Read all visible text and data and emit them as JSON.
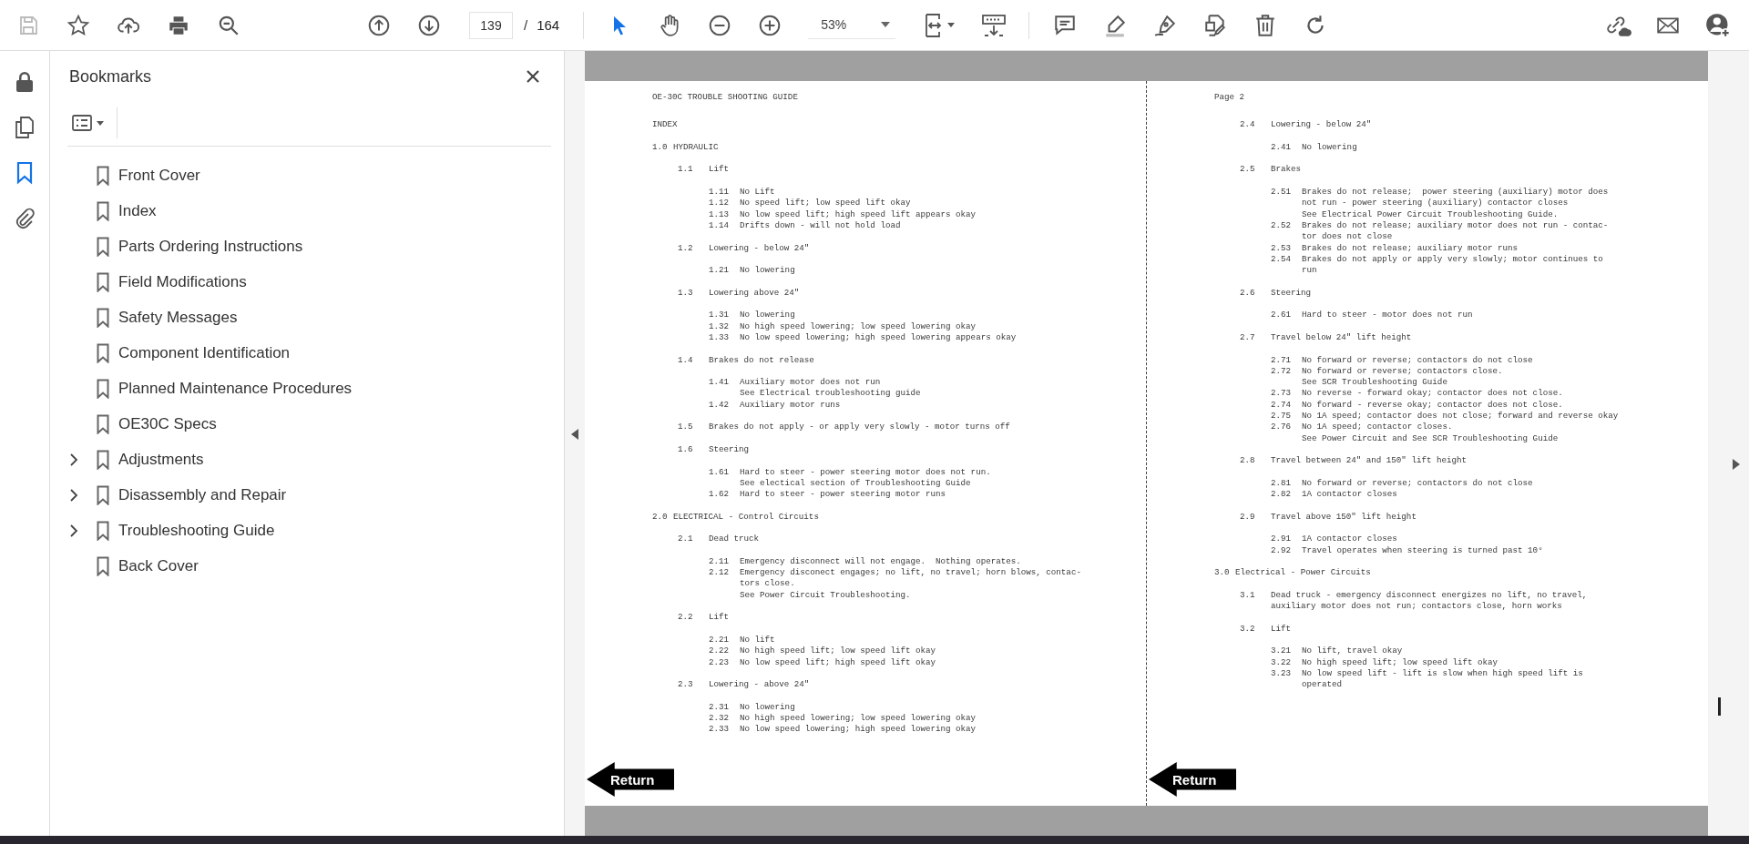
{
  "toolbar": {
    "save": {
      "disabled": true
    },
    "page_number": "139",
    "page_separator": "/",
    "page_count": "164",
    "zoom": "53%",
    "tools": [
      {
        "kind": "select",
        "selected": true
      },
      {
        "kind": "hand",
        "selected": false
      }
    ]
  },
  "nav_rail": [
    {
      "kind": "lock",
      "selected": false
    },
    {
      "kind": "pages",
      "selected": false
    },
    {
      "kind": "bookmarks",
      "selected": true
    },
    {
      "kind": "attachments",
      "selected": false
    }
  ],
  "bookmarks_panel": {
    "title": "Bookmarks",
    "items": [
      {
        "label": "Front Cover",
        "expandable": false
      },
      {
        "label": "Index",
        "expandable": false
      },
      {
        "label": "Parts Ordering Instructions",
        "expandable": false
      },
      {
        "label": "Field Modifications",
        "expandable": false
      },
      {
        "label": "Safety Messages",
        "expandable": false
      },
      {
        "label": "Component Identification",
        "expandable": false
      },
      {
        "label": "Planned Maintenance Procedures",
        "expandable": false
      },
      {
        "label": "OE30C Specs",
        "expandable": false
      },
      {
        "label": "Adjustments",
        "expandable": true
      },
      {
        "label": "Disassembly and Repair",
        "expandable": true
      },
      {
        "label": "Troubleshooting Guide",
        "expandable": true
      },
      {
        "label": "Back Cover",
        "expandable": false
      }
    ]
  },
  "document": {
    "pages": [
      {
        "return_link": "Return",
        "blocks": [
          {
            "kind": "header",
            "lines": [
              "OE-30C TROUBLE SHOOTING GUIDE"
            ]
          },
          {
            "kind": "title",
            "lines": [
              "INDEX"
            ]
          },
          {
            "kind": "section",
            "number": "1.0",
            "lines": [
              "HYDRAULIC"
            ]
          },
          {
            "kind": "subsection",
            "number": "1.1",
            "lines": [
              "Lift"
            ]
          },
          {
            "kind": "item",
            "number": "1.11",
            "lines": [
              "No Lift"
            ]
          },
          {
            "kind": "item",
            "number": "1.12",
            "lines": [
              "No speed lift; low speed lift okay"
            ]
          },
          {
            "kind": "item",
            "number": "1.13",
            "lines": [
              "No low speed lift; high speed lift appears okay"
            ]
          },
          {
            "kind": "item",
            "number": "1.14",
            "lines": [
              "Drifts down - will not hold load"
            ]
          },
          {
            "kind": "subsection",
            "number": "1.2",
            "lines": [
              "Lowering - below 24\""
            ]
          },
          {
            "kind": "item",
            "number": "1.21",
            "lines": [
              "No lowering"
            ]
          },
          {
            "kind": "subsection",
            "number": "1.3",
            "lines": [
              "Lowering above 24\""
            ]
          },
          {
            "kind": "item",
            "number": "1.31",
            "lines": [
              "No lowering"
            ]
          },
          {
            "kind": "item",
            "number": "1.32",
            "lines": [
              "No high speed lowering; low speed lowering okay"
            ]
          },
          {
            "kind": "item",
            "number": "1.33",
            "lines": [
              "No low speed lowering; high speed lowering appears okay"
            ]
          },
          {
            "kind": "subsection",
            "number": "1.4",
            "lines": [
              "Brakes do not release"
            ]
          },
          {
            "kind": "item",
            "number": "1.41",
            "lines": [
              "Auxiliary motor does not run",
              "See Electrical troubleshooting guide"
            ]
          },
          {
            "kind": "item",
            "number": "1.42",
            "lines": [
              "Auxiliary motor runs"
            ]
          },
          {
            "kind": "subsection",
            "number": "1.5",
            "lines": [
              "Brakes do not apply - or apply very slowly - motor turns off"
            ]
          },
          {
            "kind": "subsection",
            "number": "1.6",
            "lines": [
              "Steering"
            ]
          },
          {
            "kind": "item",
            "number": "1.61",
            "lines": [
              "Hard to steer - power steering motor does not run.",
              "See electical section of Troubleshooting Guide"
            ]
          },
          {
            "kind": "item",
            "number": "1.62",
            "lines": [
              "Hard to steer - power steering motor runs"
            ]
          },
          {
            "kind": "section",
            "number": "2.0",
            "lines": [
              "ELECTRICAL - Control Circuits"
            ]
          },
          {
            "kind": "subsection",
            "number": "2.1",
            "lines": [
              "Dead truck"
            ]
          },
          {
            "kind": "item",
            "number": "2.11",
            "lines": [
              "Emergency disconnect will not engage.  Nothing operates."
            ]
          },
          {
            "kind": "item",
            "number": "2.12",
            "lines": [
              "Emergency disconect engages; no lift, no travel; horn blows, contac-",
              "tors close.",
              "See Power Circuit Troubleshooting."
            ]
          },
          {
            "kind": "subsection",
            "number": "2.2",
            "lines": [
              "Lift"
            ]
          },
          {
            "kind": "item",
            "number": "2.21",
            "lines": [
              "No lift"
            ]
          },
          {
            "kind": "item",
            "number": "2.22",
            "lines": [
              "No high speed lift; low speed lift okay"
            ]
          },
          {
            "kind": "item",
            "number": "2.23",
            "lines": [
              "No low speed lift; high speed lift okay"
            ]
          },
          {
            "kind": "subsection",
            "number": "2.3",
            "lines": [
              "Lowering - above 24\""
            ]
          },
          {
            "kind": "item",
            "number": "2.31",
            "lines": [
              "No lowering"
            ]
          },
          {
            "kind": "item",
            "number": "2.32",
            "lines": [
              "No high speed lowering; low speed lowering okay"
            ]
          },
          {
            "kind": "item",
            "number": "2.33",
            "lines": [
              "No low speed lowering; high speed lowering okay"
            ]
          }
        ]
      },
      {
        "return_link": "Return",
        "blocks": [
          {
            "kind": "header",
            "lines": [
              "Page 2"
            ]
          },
          {
            "kind": "subsection",
            "number": "2.4",
            "lines": [
              "Lowering - below 24\""
            ]
          },
          {
            "kind": "item",
            "number": "2.41",
            "lines": [
              "No lowering"
            ]
          },
          {
            "kind": "subsection",
            "number": "2.5",
            "lines": [
              "Brakes"
            ]
          },
          {
            "kind": "item",
            "number": "2.51",
            "lines": [
              "Brakes do not release;  power steering (auxiliary) motor does",
              "not run - power steering (auxiliary) contactor closes",
              "See Electrical Power Circuit Troubleshooting Guide."
            ]
          },
          {
            "kind": "item",
            "number": "2.52",
            "lines": [
              "Brakes do not release; auxiliary motor does not run - contac-",
              "tor does not close"
            ]
          },
          {
            "kind": "item",
            "number": "2.53",
            "lines": [
              "Brakes do not release; auxiliary motor runs"
            ]
          },
          {
            "kind": "item",
            "number": "2.54",
            "lines": [
              "Brakes do not apply or apply very slowly; motor continues to",
              "run"
            ]
          },
          {
            "kind": "subsection",
            "number": "2.6",
            "lines": [
              "Steering"
            ]
          },
          {
            "kind": "item",
            "number": "2.61",
            "lines": [
              "Hard to steer - motor does not run"
            ]
          },
          {
            "kind": "subsection",
            "number": "2.7",
            "lines": [
              "Travel below 24\" lift height"
            ]
          },
          {
            "kind": "item",
            "number": "2.71",
            "lines": [
              "No forward or reverse; contactors do not close"
            ]
          },
          {
            "kind": "item",
            "number": "2.72",
            "lines": [
              "No forward or reverse; contactors close.",
              "See SCR Troubleshooting Guide"
            ]
          },
          {
            "kind": "item",
            "number": "2.73",
            "lines": [
              "No reverse - forward okay; contactor does not close."
            ]
          },
          {
            "kind": "item",
            "number": "2.74",
            "lines": [
              "No forward - reverse okay; contactor does not close."
            ]
          },
          {
            "kind": "item",
            "number": "2.75",
            "lines": [
              "No 1A speed; contactor does not close; forward and reverse okay"
            ]
          },
          {
            "kind": "item",
            "number": "2.76",
            "lines": [
              "No 1A speed; contactor closes.",
              "See Power Circuit and See SCR Troubleshooting Guide"
            ]
          },
          {
            "kind": "subsection",
            "number": "2.8",
            "lines": [
              "Travel between 24\" and 150\" lift height"
            ]
          },
          {
            "kind": "item",
            "number": "2.81",
            "lines": [
              "No forward or reverse; contactors do not close"
            ]
          },
          {
            "kind": "item",
            "number": "2.82",
            "lines": [
              "1A contactor closes"
            ]
          },
          {
            "kind": "subsection",
            "number": "2.9",
            "lines": [
              "Travel above 150\" lift height"
            ]
          },
          {
            "kind": "item",
            "number": "2.91",
            "lines": [
              "1A contactor closes"
            ]
          },
          {
            "kind": "item",
            "number": "2.92",
            "lines": [
              "Travel operates when steering is turned past 10°"
            ]
          },
          {
            "kind": "section",
            "number": "3.0",
            "lines": [
              "Electrical - Power Circuits"
            ]
          },
          {
            "kind": "subsection",
            "number": "3.1",
            "lines": [
              "Dead truck - emergency disconnect energizes no lift, no travel,",
              "auxiliary motor does not run; contactors close, horn works"
            ]
          },
          {
            "kind": "subsection",
            "number": "3.2",
            "lines": [
              "Lift"
            ]
          },
          {
            "kind": "item",
            "number": "3.21",
            "lines": [
              "No lift, travel okay"
            ]
          },
          {
            "kind": "item",
            "number": "3.22",
            "lines": [
              "No high speed lift; low speed lift okay"
            ]
          },
          {
            "kind": "item",
            "number": "3.23",
            "lines": [
              "No low speed lift - lift is slow when high speed lift is",
              "operated"
            ]
          }
        ]
      }
    ]
  }
}
